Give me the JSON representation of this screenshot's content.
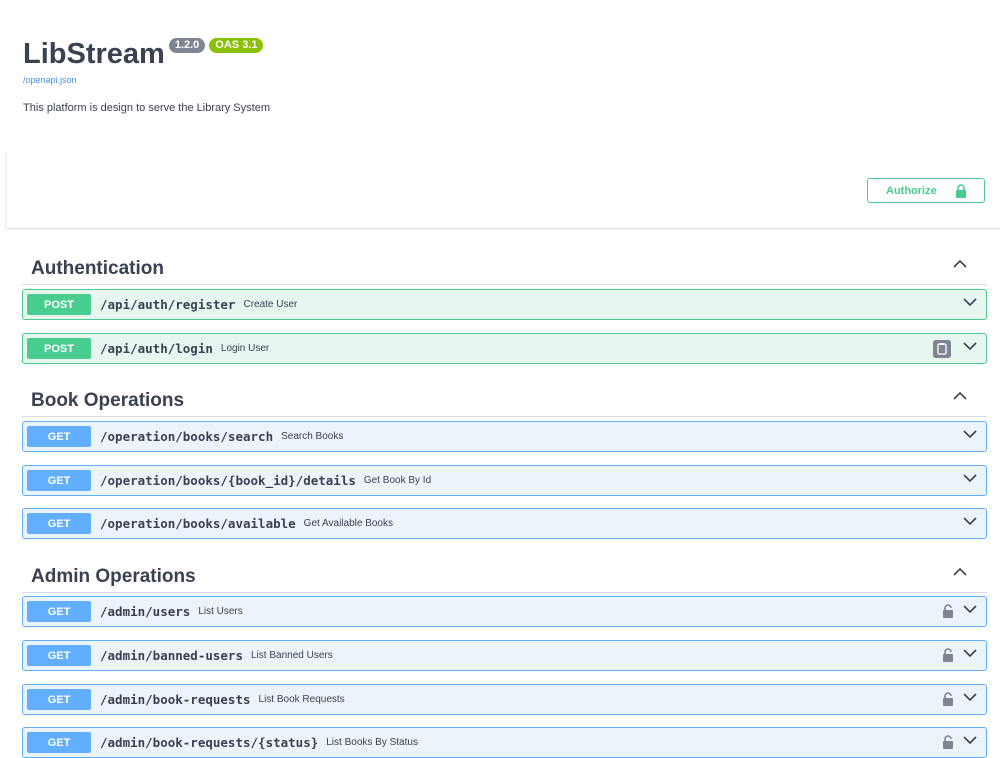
{
  "info": {
    "title": "LibStream",
    "version": "1.2.0",
    "oas": "OAS 3.1",
    "spec_link": "/openapi.json",
    "description": "This platform is design to serve the Library System"
  },
  "authorize": {
    "label": "Authorize",
    "icon": "lock-icon",
    "color": "#49cc90"
  },
  "colors": {
    "post": "#49cc90",
    "get": "#61affe",
    "text": "#3b4151"
  },
  "sections": [
    {
      "name": "Authentication",
      "operations": [
        {
          "method": "POST",
          "path": "/api/auth/register",
          "summary": "Create User"
        },
        {
          "method": "POST",
          "path": "/api/auth/login",
          "summary": "Login User"
        }
      ]
    },
    {
      "name": "Book Operations",
      "operations": [
        {
          "method": "GET",
          "path": "/operation/books/search",
          "summary": "Search Books"
        },
        {
          "method": "GET",
          "path": "/operation/books/{book_id}/details",
          "summary": "Get Book By Id"
        },
        {
          "method": "GET",
          "path": "/operation/books/available",
          "summary": "Get Available Books"
        }
      ]
    },
    {
      "name": "Admin Operations",
      "operations": [
        {
          "method": "GET",
          "path": "/admin/users",
          "summary": "List Users"
        },
        {
          "method": "GET",
          "path": "/admin/banned-users",
          "summary": "List Banned Users"
        },
        {
          "method": "GET",
          "path": "/admin/book-requests",
          "summary": "List Book Requests"
        },
        {
          "method": "GET",
          "path": "/admin/book-requests/{status}",
          "summary": "List Books By Status"
        }
      ]
    }
  ]
}
